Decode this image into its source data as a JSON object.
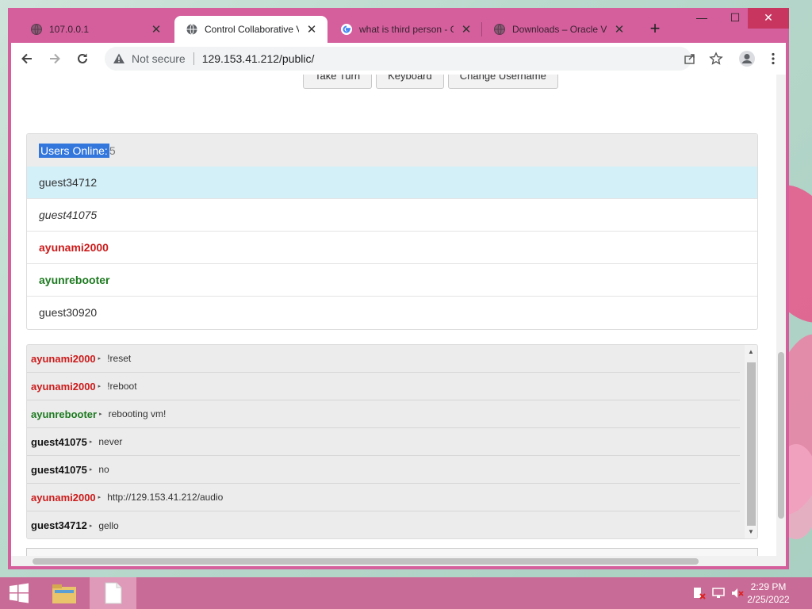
{
  "browser": {
    "tabs": [
      {
        "title": "107.0.0.1",
        "active": false,
        "favicon": "globe-icon"
      },
      {
        "title": "Control Collaborative Vir",
        "active": true,
        "favicon": "globe-icon"
      },
      {
        "title": "what is third person - G",
        "active": false,
        "favicon": "google-icon"
      },
      {
        "title": "Downloads – Oracle VM",
        "active": false,
        "favicon": "globe-icon"
      }
    ],
    "new_tab": "+",
    "window_controls": {
      "minimize": "—",
      "maximize": "☐",
      "close": "✕"
    },
    "address_bar": {
      "security_text": "Not secure",
      "url": "129.153.41.212/public/"
    }
  },
  "page": {
    "top_buttons": [
      "Take Turn",
      "Keyboard",
      "Change Username"
    ],
    "users_panel": {
      "label": "Users Online:",
      "count": "5",
      "users": [
        {
          "name": "guest34712",
          "style": "selected"
        },
        {
          "name": "guest41075",
          "style": "italic"
        },
        {
          "name": "ayunami2000",
          "style": "red"
        },
        {
          "name": "ayunrebooter",
          "style": "green"
        },
        {
          "name": "guest30920",
          "style": "normal"
        }
      ]
    },
    "chat": {
      "messages": [
        {
          "user": "ayunami2000",
          "color": "red",
          "text": "!reset"
        },
        {
          "user": "ayunami2000",
          "color": "red",
          "text": "!reboot"
        },
        {
          "user": "ayunrebooter",
          "color": "green",
          "text": "rebooting vm!"
        },
        {
          "user": "guest41075",
          "color": "black",
          "text": "never"
        },
        {
          "user": "guest41075",
          "color": "black",
          "text": "no"
        },
        {
          "user": "ayunami2000",
          "color": "red",
          "text": "http://129.153.41.212/audio"
        },
        {
          "user": "guest34712",
          "color": "black",
          "text": "gello"
        }
      ]
    }
  },
  "taskbar": {
    "clock_time": "2:29 PM",
    "clock_date": "2/25/2022"
  },
  "colors": {
    "titlebar": "#d45f9c",
    "taskbar": "#c86b96",
    "user_red": "#cc1a1a",
    "user_green": "#1d7a20",
    "selected_row": "#d3f0f9"
  }
}
